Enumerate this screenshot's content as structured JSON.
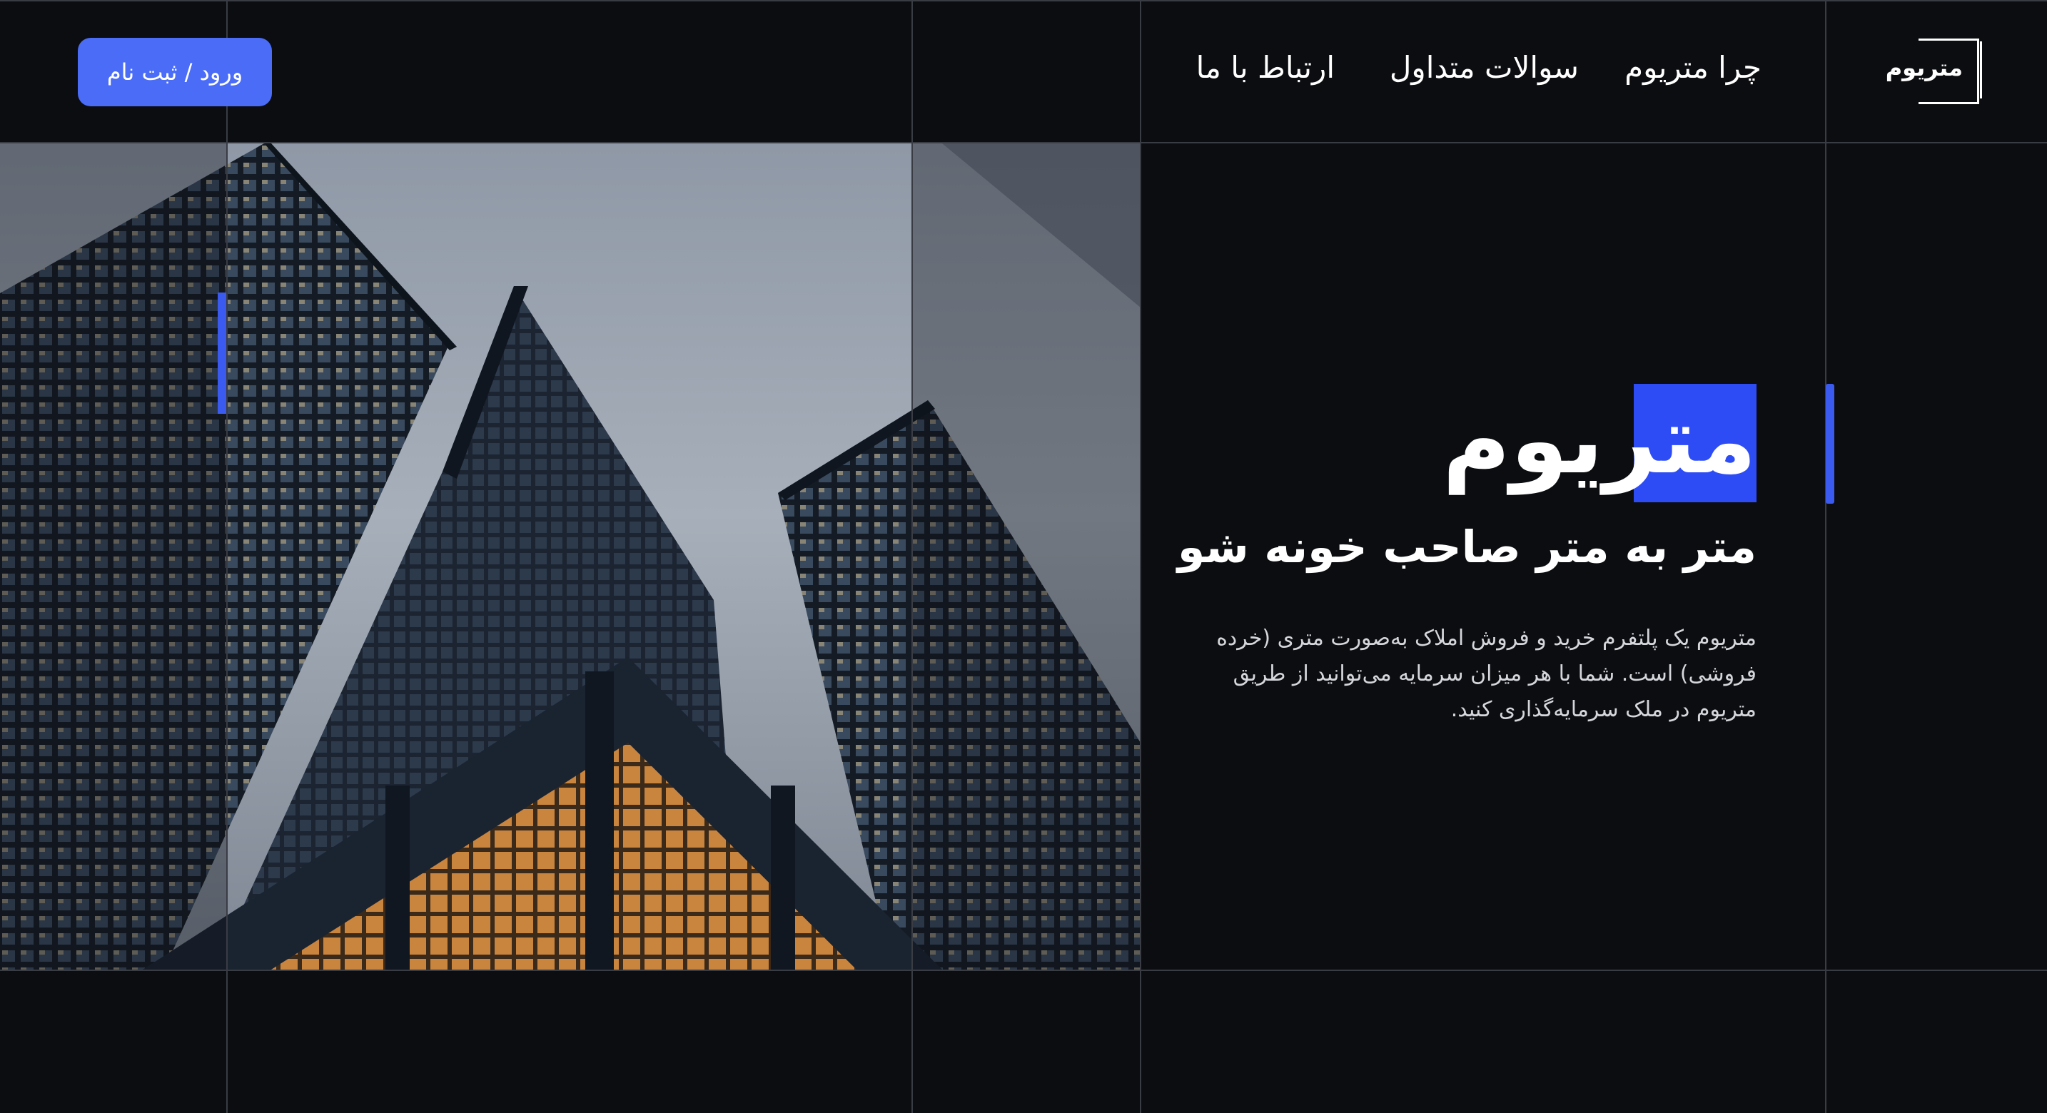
{
  "header": {
    "logo_text": "متریوم",
    "nav": [
      {
        "label": "چرا متریوم"
      },
      {
        "label": "سوالات متداول"
      },
      {
        "label": "ارتباط با ما"
      }
    ],
    "login_label": "ورود / ثبت نام"
  },
  "hero": {
    "title": "متریوم",
    "subtitle": "متر به متر صاحب خونه شو",
    "description": "متریوم یک پلتفرم خرید و فروش املاک به‌صورت متری (خرده فروشی) است. شما با هر میزان سرمایه می‌توانید از طریق متریوم در ملک سرمایه‌گذاری کنید."
  },
  "colors": {
    "background": "#0c0d10",
    "accent": "#2d4cf5",
    "button": "#4a6cf7",
    "grid_line": "#3a3c44"
  }
}
